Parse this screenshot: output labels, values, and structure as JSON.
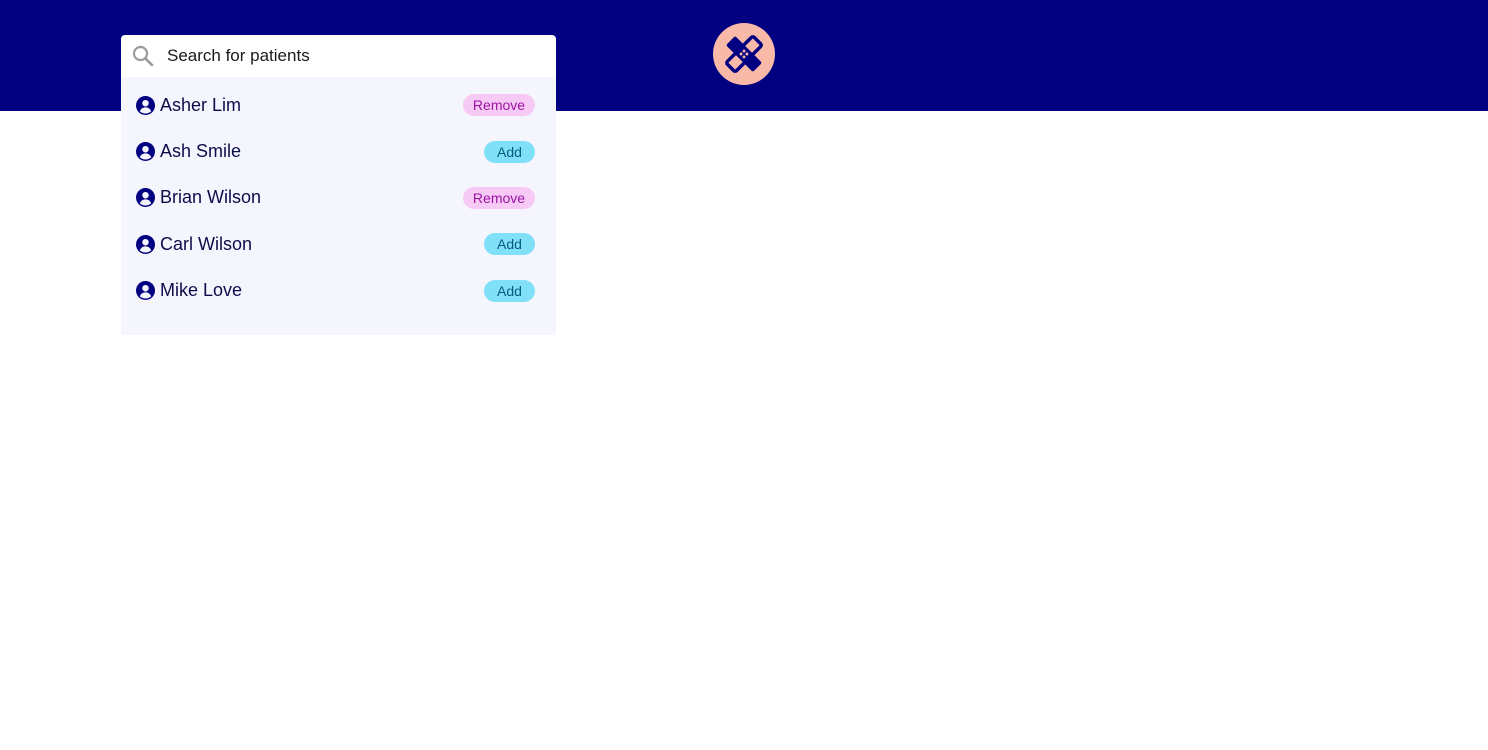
{
  "header": {
    "logo_icon": "bandage-icon",
    "background_color": "#000080",
    "logo_background_color": "#f9b9a8"
  },
  "search": {
    "icon": "search-icon",
    "placeholder": "Search for patients",
    "value": ""
  },
  "patients": [
    {
      "name": "Asher Lim",
      "action": "Remove",
      "action_type": "remove"
    },
    {
      "name": "Ash Smile",
      "action": "Add",
      "action_type": "add"
    },
    {
      "name": "Brian Wilson",
      "action": "Remove",
      "action_type": "remove"
    },
    {
      "name": "Carl Wilson",
      "action": "Add",
      "action_type": "add"
    },
    {
      "name": "Mike Love",
      "action": "Add",
      "action_type": "add"
    }
  ],
  "colors": {
    "remove_bg": "#f7c9f5",
    "remove_text": "#9b12a4",
    "add_bg": "#7fe0f7",
    "add_text": "#075a80"
  }
}
